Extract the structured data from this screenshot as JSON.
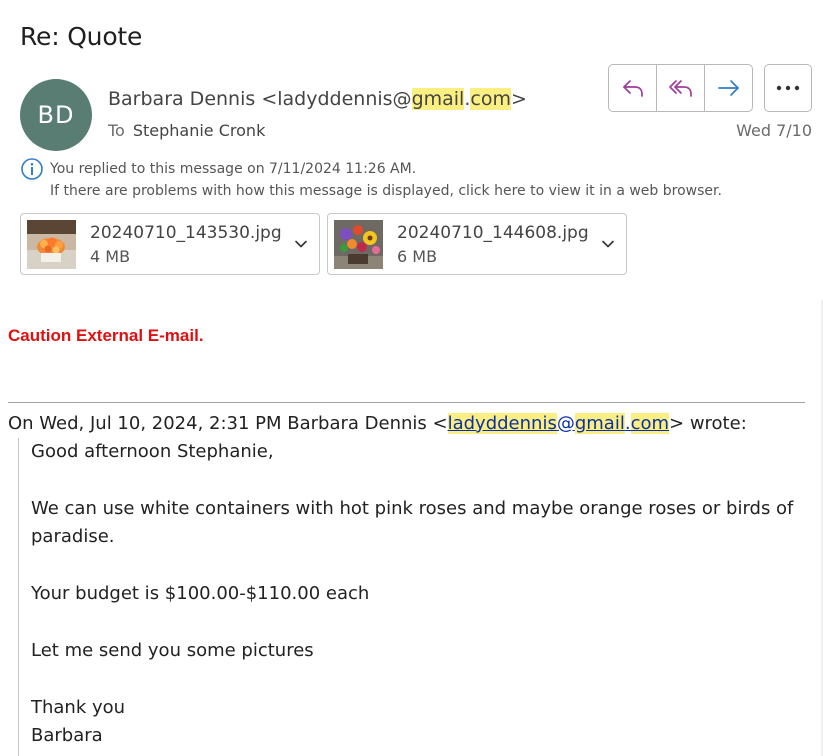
{
  "subject": "Re: Quote",
  "sender": {
    "initials": "BD",
    "avatar_color": "#5a7d73",
    "name": "Barbara Dennis",
    "email_user": "ladyddennis@",
    "email_domain": "gmail",
    "email_dot": ".",
    "email_tld": "com",
    "open_bracket": " <",
    "close_bracket": ">"
  },
  "recipient": {
    "label": "To",
    "name": "Stephanie Cronk"
  },
  "date": "Wed 7/10",
  "actions": {
    "reply": "reply-icon",
    "reply_all": "reply-all-icon",
    "forward": "forward-icon",
    "more": "more-icon"
  },
  "info": {
    "line1": "You replied to this message on 7/11/2024 11:26 AM.",
    "line2": "If there are problems with how this message is displayed, click here to view it in a web browser."
  },
  "attachments": [
    {
      "name": "20240710_143530.jpg",
      "size": "4 MB"
    },
    {
      "name": "20240710_144608.jpg",
      "size": "6 MB"
    }
  ],
  "caution": "Caution External E-mail.",
  "quote": {
    "prefix": "On Wed, Jul 10, 2024, 2:31 PM Barbara Dennis <",
    "link_user": "ladyddennis",
    "link_at": "@",
    "link_domain": "gmail",
    "link_dot": ".",
    "link_tld": "com",
    "suffix": "> wrote:",
    "lines": [
      "Good afternoon Stephanie,",
      "We can use white containers with hot pink roses and maybe orange roses or birds of",
      "paradise.",
      "Your budget is $100.00-$110.00 each",
      "Let me send you some pictures",
      "Thank you",
      "Barbara"
    ]
  },
  "colors": {
    "highlight": "#fbef82",
    "caution": "#e01010",
    "link": "#0b2fa8",
    "icon_reply": "#a03d9b",
    "icon_forward": "#2f7fc8"
  }
}
